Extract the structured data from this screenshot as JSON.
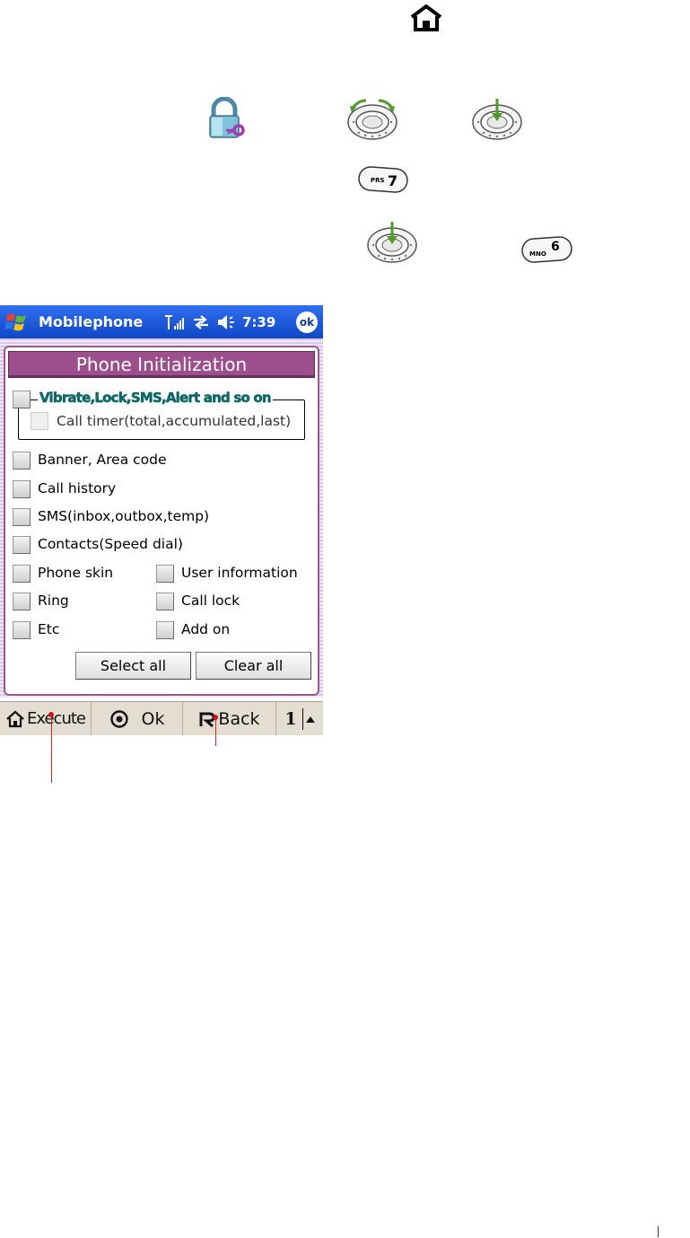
{
  "illustration": {
    "row1_icons": [
      "home-icon"
    ],
    "row2_icons": [
      "lock-key-icon",
      "navigation-rotate-icon",
      "navigation-press-icon"
    ],
    "row3_icons": [
      "key-7-prs-icon"
    ],
    "row3_key": {
      "letters": "PRS",
      "digit": "7"
    },
    "row4_icons": [
      "navigation-press-icon",
      "key-6-mno-icon"
    ],
    "row4_key": {
      "letters": "MNO",
      "digit": "6"
    }
  },
  "taskbar": {
    "app_title": "Mobilephone",
    "time": "7:39",
    "ok_label": "ok",
    "status_icons": [
      "signal-icon",
      "connectivity-icon",
      "volume-icon"
    ]
  },
  "dialog": {
    "title": "Phone Initialization",
    "group": {
      "label": "Vibrate,Lock,SMS,Alert and so on",
      "sub_item": "Call timer(total,accumulated,last)"
    },
    "items": [
      "Banner, Area code",
      "Call history",
      "SMS(inbox,outbox,temp)",
      "Contacts(Speed dial)"
    ],
    "grid": [
      {
        "left": "Phone skin",
        "right": "User information"
      },
      {
        "left": "Ring",
        "right": "Call lock"
      },
      {
        "left": "Etc",
        "right": "Add on"
      }
    ],
    "buttons": {
      "select_all": "Select all",
      "clear_all": "Clear all"
    }
  },
  "menubar": {
    "execute": "Execute",
    "ok": "Ok",
    "back": "Back",
    "page": "1"
  },
  "colors": {
    "taskbar": "#1f5ae0",
    "dialog_title_bg": "#9c4f8c",
    "dialog_border": "#9a5a90",
    "menubar_bg": "#e4ddd2",
    "callout": "#c52a2a"
  }
}
